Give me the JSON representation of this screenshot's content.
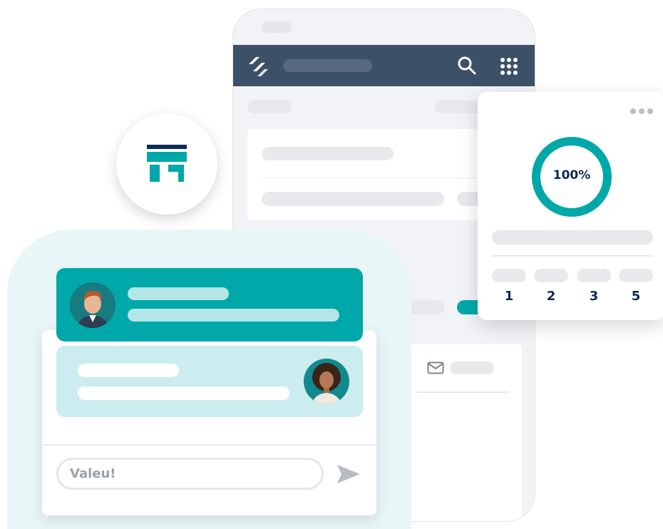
{
  "stats_card": {
    "progress_label": "100%",
    "progress_fraction": 1.0,
    "ratings": [
      "1",
      "2",
      "3",
      "5"
    ]
  },
  "chat": {
    "input_value": "Valeu!"
  },
  "colors": {
    "teal": "#00a8a9",
    "teal_light": "#cbedef",
    "navy": "#0d2a50",
    "header": "#3c5068"
  },
  "icons": [
    "logo-icon",
    "search-icon",
    "grid-menu-icon",
    "store-icon",
    "more-dots-icon",
    "mail-icon",
    "send-icon"
  ]
}
